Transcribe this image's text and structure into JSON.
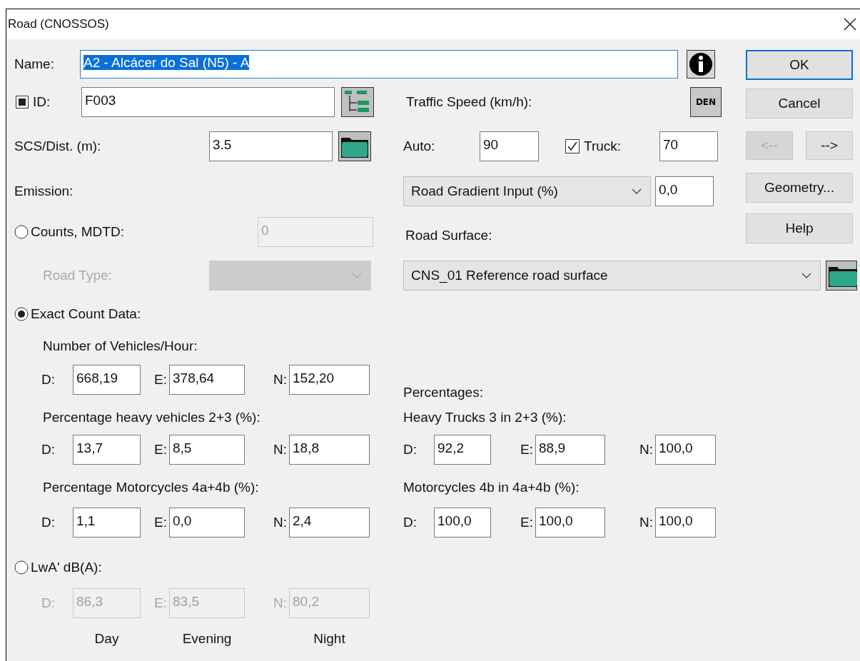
{
  "window": {
    "title": "Road (CNOSSOS)"
  },
  "name": {
    "label": "Name:",
    "value": "A2 - Alcácer do Sal (N5) - A",
    "selected": true
  },
  "id": {
    "label": "ID:",
    "checked": true,
    "value": "F003"
  },
  "scs_dist": {
    "label": "SCS/Dist. (m):",
    "value": "3.5"
  },
  "emission_label": "Emission:",
  "traffic_speed": {
    "label": "Traffic Speed (km/h):",
    "den_button": "DEN",
    "auto_label": "Auto:",
    "auto_value": "90",
    "truck_checked": true,
    "truck_label": "Truck:",
    "truck_value": "70"
  },
  "road_gradient": {
    "option": "Road Gradient Input (%)",
    "value": "0,0"
  },
  "counts_mdtd": {
    "label": "Counts, MDTD:",
    "selected": false,
    "value": "0",
    "disabled": true
  },
  "road_type": {
    "label": "Road Type:",
    "disabled": true
  },
  "road_surface": {
    "label": "Road Surface:",
    "option": "CNS_01 Reference road surface"
  },
  "exact_count": {
    "label": "Exact Count Data:",
    "selected": true,
    "vehicles_label": "Number of Vehicles/Hour:",
    "vehicles": [
      {
        "label": "D:",
        "value": "668,19"
      },
      {
        "label": "E:",
        "value": "378,64"
      },
      {
        "label": "N:",
        "value": "152,20"
      }
    ],
    "percentages_label": "Percentages:",
    "heavy_label": "Percentage heavy vehicles 2+3 (%):",
    "heavy": [
      {
        "label": "D:",
        "value": "13,7"
      },
      {
        "label": "E:",
        "value": "8,5"
      },
      {
        "label": "N:",
        "value": "18,8"
      }
    ],
    "heavy_trucks_label": "Heavy Trucks 3 in 2+3 (%):",
    "heavy_trucks": [
      {
        "label": "D:",
        "value": "92,2"
      },
      {
        "label": "E:",
        "value": "88,9"
      },
      {
        "label": "N:",
        "value": "100,0"
      }
    ],
    "moto_label": "Percentage Motorcycles  4a+4b (%):",
    "moto": [
      {
        "label": "D:",
        "value": "1,1"
      },
      {
        "label": "E:",
        "value": "0,0"
      },
      {
        "label": "N:",
        "value": "2,4"
      }
    ],
    "moto4b_label": "Motorcycles 4b in 4a+4b (%):",
    "moto4b": [
      {
        "label": "D:",
        "value": "100,0"
      },
      {
        "label": "E:",
        "value": "100,0"
      },
      {
        "label": "N:",
        "value": "100,0"
      }
    ]
  },
  "lwa": {
    "label": "LwA' dB(A):",
    "selected": false,
    "disabled": true,
    "values": [
      {
        "label": "D:",
        "value": "86,3"
      },
      {
        "label": "E:",
        "value": "83,5"
      },
      {
        "label": "N:",
        "value": "80,2"
      }
    ]
  },
  "periods": [
    "Day",
    "Evening",
    "Night"
  ],
  "buttons": [
    {
      "label": "OK",
      "default": true,
      "disabled": false
    },
    {
      "label": "Cancel",
      "default": false,
      "disabled": false
    },
    {
      "label": "<--",
      "default": false,
      "disabled": true
    },
    {
      "label": "-->",
      "default": false,
      "disabled": false
    },
    {
      "label": "Geometry...",
      "default": false,
      "disabled": false
    },
    {
      "label": "Help",
      "default": false,
      "disabled": false
    }
  ]
}
